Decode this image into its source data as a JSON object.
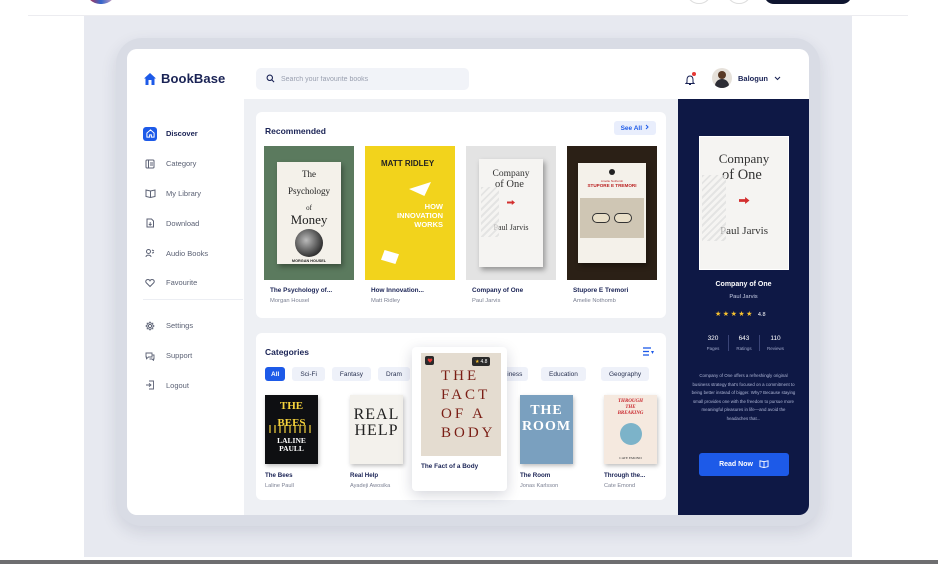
{
  "app": {
    "name": "BookBase"
  },
  "search": {
    "placeholder": "Search your favourite books"
  },
  "user": {
    "name": "Balogun"
  },
  "nav": {
    "items": [
      {
        "label": "Discover",
        "icon": "home-icon",
        "active": true
      },
      {
        "label": "Category",
        "icon": "category-icon"
      },
      {
        "label": "My Library",
        "icon": "book-open-icon"
      },
      {
        "label": "Download",
        "icon": "download-icon"
      },
      {
        "label": "Audio Books",
        "icon": "headphones-icon"
      },
      {
        "label": "Favourite",
        "icon": "heart-icon"
      }
    ],
    "secondary": [
      {
        "label": "Settings",
        "icon": "gear-icon"
      },
      {
        "label": "Support",
        "icon": "chat-icon"
      },
      {
        "label": "Logout",
        "icon": "logout-icon"
      }
    ]
  },
  "recommended": {
    "title": "Recommended",
    "see_all": "See All",
    "books": [
      {
        "title": "The Psychology of...",
        "author": "Morgan Housel",
        "cover": {
          "line1": "The",
          "line2": "Psychology",
          "line3": "of",
          "line4": "Money",
          "author": "MORGAN HOUSEL"
        }
      },
      {
        "title": "How Innovation...",
        "author": "Matt Ridley",
        "cover": {
          "author": "MATT RIDLEY",
          "line1": "HOW",
          "line2": "INNOVATION",
          "line3": "WORKS"
        }
      },
      {
        "title": "Company of One",
        "author": "Paul Jarvis",
        "cover": {
          "line1": "Company",
          "line2": "of One",
          "author": "Paul Jarvis"
        }
      },
      {
        "title": "Stupore E Tremori",
        "author": "Amelie Nothomb",
        "cover": {
          "author": "Amélie Nothomb",
          "line1": "STUPORE E TREMORI"
        }
      }
    ]
  },
  "categories": {
    "title": "Categories",
    "chips": [
      "All",
      "Sci-Fi",
      "Fantasy",
      "Dram",
      "siness",
      "Education",
      "Geography"
    ],
    "books": [
      {
        "title": "The Bees",
        "author": "Laline Paull",
        "cover": {
          "line1": "THE",
          "line2": "BEES",
          "line3": "LALINE",
          "line4": "PAULL"
        }
      },
      {
        "title": "Real Help",
        "author": "Ayadeji Awosika",
        "cover": {
          "line1": "REAL",
          "line2": "HELP"
        }
      },
      {
        "title": "The Room",
        "author": "Jonas Karlsson",
        "cover": {
          "line1": "THE",
          "line2": "ROOM"
        }
      },
      {
        "title": "Through the...",
        "author": "Cate Emond",
        "cover": {
          "line1": "THROUGH",
          "line2": "THE",
          "line3": "BREAKING",
          "author": "CATE EMOND"
        }
      }
    ],
    "featured": {
      "title": "The Fact of a Body",
      "rating": "4.8",
      "cover": {
        "line1": "THE",
        "line2": "FACT",
        "line3": "OF A",
        "line4": "BODY"
      }
    }
  },
  "detail": {
    "title": "Company of One",
    "author": "Paul Jarvis",
    "rating": "4.8",
    "stats": [
      {
        "value": "320",
        "label": "Pages"
      },
      {
        "value": "643",
        "label": "Ratings"
      },
      {
        "value": "110",
        "label": "Reviews"
      }
    ],
    "description": "Company of One offers a refreshingly original business strategy that's focused on a commitment to being better instead of bigger. Why? Because staying small provides one with the freedom to pursue more meaningful pleasures in life—and avoid the headaches that...",
    "read_button": "Read Now"
  },
  "colors": {
    "accent": "#1d5ae8",
    "navy": "#0e1845",
    "star": "#f7c12f"
  }
}
